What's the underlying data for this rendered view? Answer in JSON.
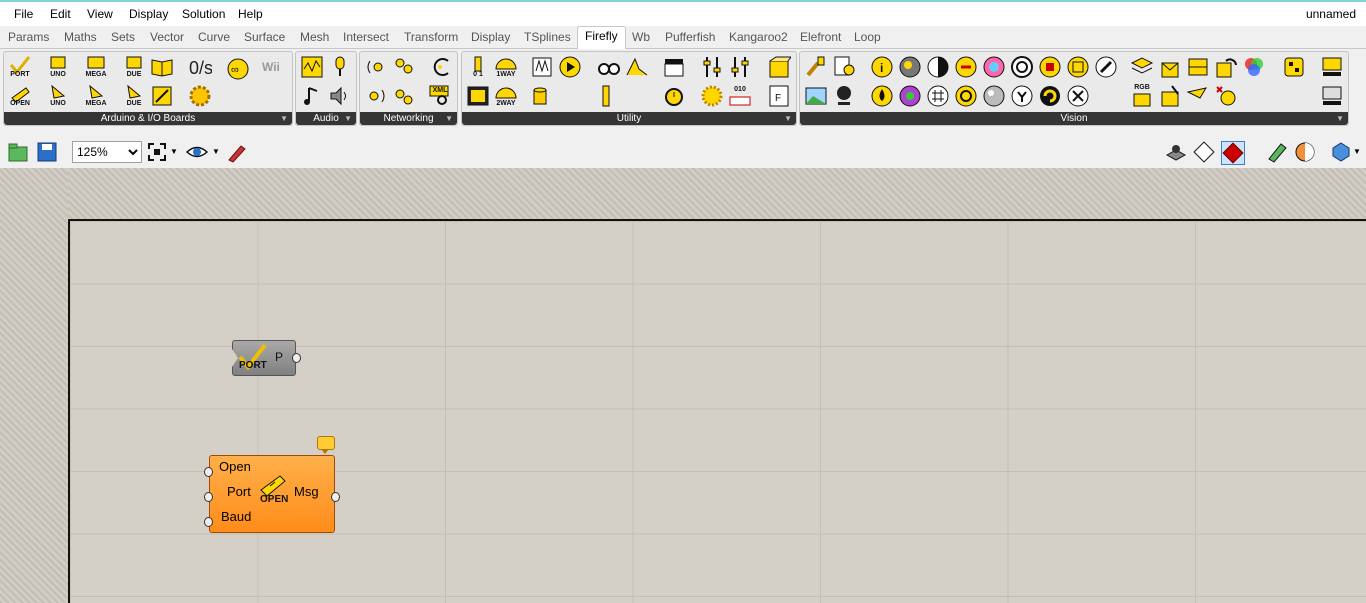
{
  "menu": {
    "items": [
      "File",
      "Edit",
      "View",
      "Display",
      "Solution",
      "Help"
    ],
    "document_title": "unnamed"
  },
  "tabs": {
    "items": [
      "Params",
      "Maths",
      "Sets",
      "Vector",
      "Curve",
      "Surface",
      "Mesh",
      "Intersect",
      "Transform",
      "Display",
      "TSplines",
      "Firefly",
      "Wb",
      "Pufferfish",
      "Kangaroo2",
      "Elefront",
      "Loop"
    ],
    "active": "Firefly"
  },
  "ribbon": {
    "panels": {
      "arduino": {
        "title": "Arduino & I/O Boards",
        "labels": [
          "PORT",
          "UNO",
          "MEGA",
          "DUE",
          "OPEN",
          "UNO",
          "MEGA",
          "DUE"
        ],
        "wii": "Wii"
      },
      "audio": {
        "title": "Audio"
      },
      "networking": {
        "title": "Networking",
        "xml": "XML"
      },
      "utility": {
        "title": "Utility",
        "labels": [
          "0 1",
          "1WAY",
          "2WAY",
          "010"
        ]
      },
      "vision": {
        "title": "Vision",
        "rgb": "RGB"
      }
    }
  },
  "toolbar": {
    "zoom": "125%",
    "zoom_options": [
      "125%"
    ]
  },
  "canvas": {
    "port_component": {
      "icon_label": "PORT",
      "output": "P"
    },
    "open_component": {
      "inputs": [
        "Open",
        "Port",
        "Baud"
      ],
      "output": "Msg",
      "icon_label": "OPEN"
    }
  },
  "colors": {
    "component_orange": "#ff8c1a",
    "component_gray": "#8e8e8e",
    "canvas_bg": "#d4d0c8",
    "panel_bar": "#353535",
    "icon_yellow": "#ffd700"
  }
}
